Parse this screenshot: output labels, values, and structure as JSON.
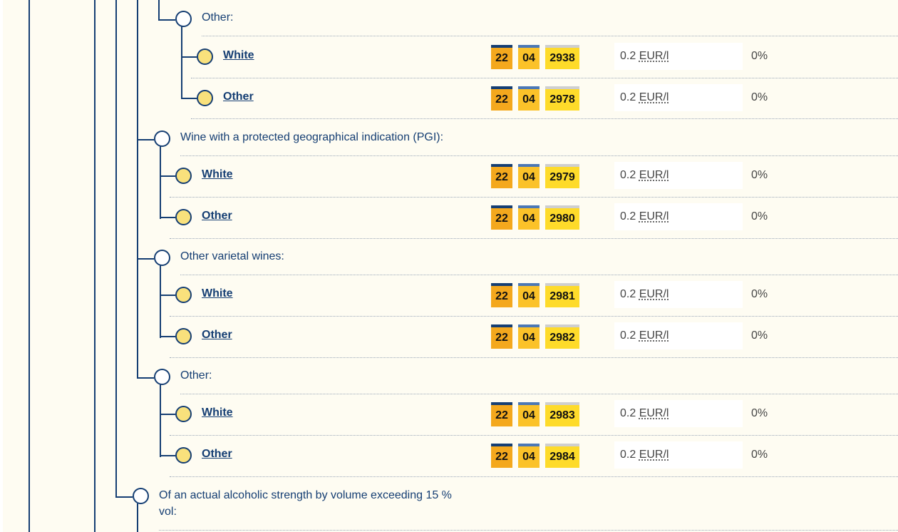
{
  "headings": {
    "h1": "Other:",
    "h2": "Wine with a protected geographical indication (PGI):",
    "h3": "Other varietal wines:",
    "h4": "Other:",
    "h5": "Of an actual alcoholic strength by volume exceeding 15 % vol:"
  },
  "rows": [
    {
      "label": "White",
      "code": [
        "22",
        "04",
        "2938"
      ],
      "duty_amount": "0.2",
      "duty_unit": "EUR/l",
      "rate": "0%"
    },
    {
      "label": "Other",
      "code": [
        "22",
        "04",
        "2978"
      ],
      "duty_amount": "0.2",
      "duty_unit": "EUR/l",
      "rate": "0%"
    },
    {
      "label": "White",
      "code": [
        "22",
        "04",
        "2979"
      ],
      "duty_amount": "0.2",
      "duty_unit": "EUR/l",
      "rate": "0%"
    },
    {
      "label": "Other",
      "code": [
        "22",
        "04",
        "2980"
      ],
      "duty_amount": "0.2",
      "duty_unit": "EUR/l",
      "rate": "0%"
    },
    {
      "label": "White",
      "code": [
        "22",
        "04",
        "2981"
      ],
      "duty_amount": "0.2",
      "duty_unit": "EUR/l",
      "rate": "0%"
    },
    {
      "label": "Other",
      "code": [
        "22",
        "04",
        "2982"
      ],
      "duty_amount": "0.2",
      "duty_unit": "EUR/l",
      "rate": "0%"
    },
    {
      "label": "White",
      "code": [
        "22",
        "04",
        "2983"
      ],
      "duty_amount": "0.2",
      "duty_unit": "EUR/l",
      "rate": "0%"
    },
    {
      "label": "Other",
      "code": [
        "22",
        "04",
        "2984"
      ],
      "duty_amount": "0.2",
      "duty_unit": "EUR/l",
      "rate": "0%"
    }
  ],
  "colors": {
    "tree_line": "#153e73",
    "leaf_circle": "#f9e17c",
    "code_segment_1": "#f4a81d",
    "code_segment_2": "#fbc229",
    "code_segment_3": "#fedb2a",
    "page_background": "#fefcf2"
  }
}
